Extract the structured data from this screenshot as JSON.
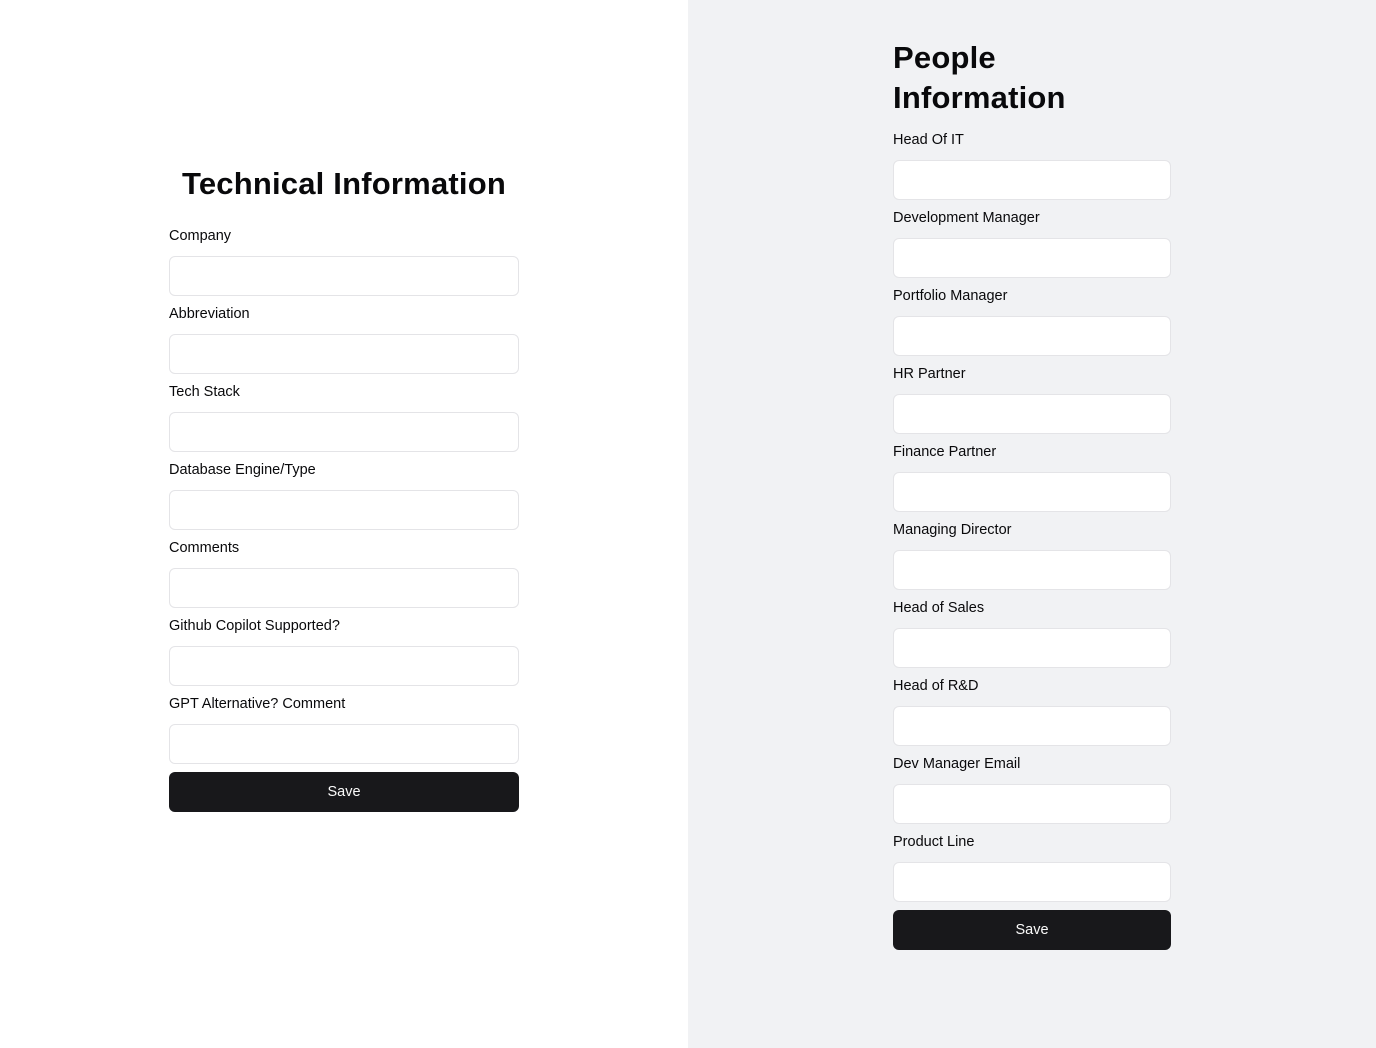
{
  "technical": {
    "title": "Technical Information",
    "fields": [
      {
        "label": "Company",
        "value": ""
      },
      {
        "label": "Abbreviation",
        "value": ""
      },
      {
        "label": "Tech Stack",
        "value": ""
      },
      {
        "label": "Database Engine/Type",
        "value": ""
      },
      {
        "label": "Comments",
        "value": ""
      },
      {
        "label": "Github Copilot Supported?",
        "value": ""
      },
      {
        "label": "GPT Alternative? Comment",
        "value": ""
      }
    ],
    "save_label": "Save"
  },
  "people": {
    "title": "People Information",
    "fields": [
      {
        "label": "Head Of IT",
        "value": ""
      },
      {
        "label": "Development Manager",
        "value": ""
      },
      {
        "label": "Portfolio Manager",
        "value": ""
      },
      {
        "label": "HR Partner",
        "value": ""
      },
      {
        "label": "Finance Partner",
        "value": ""
      },
      {
        "label": "Managing Director",
        "value": ""
      },
      {
        "label": "Head of Sales",
        "value": ""
      },
      {
        "label": "Head of R&D",
        "value": ""
      },
      {
        "label": "Dev Manager Email",
        "value": ""
      },
      {
        "label": "Product Line",
        "value": ""
      }
    ],
    "save_label": "Save"
  },
  "colors": {
    "left_background": "#ffffff",
    "right_background": "#f1f2f4",
    "button_background": "#18181b",
    "button_text": "#fafafa",
    "input_border": "#e4e4e7"
  }
}
